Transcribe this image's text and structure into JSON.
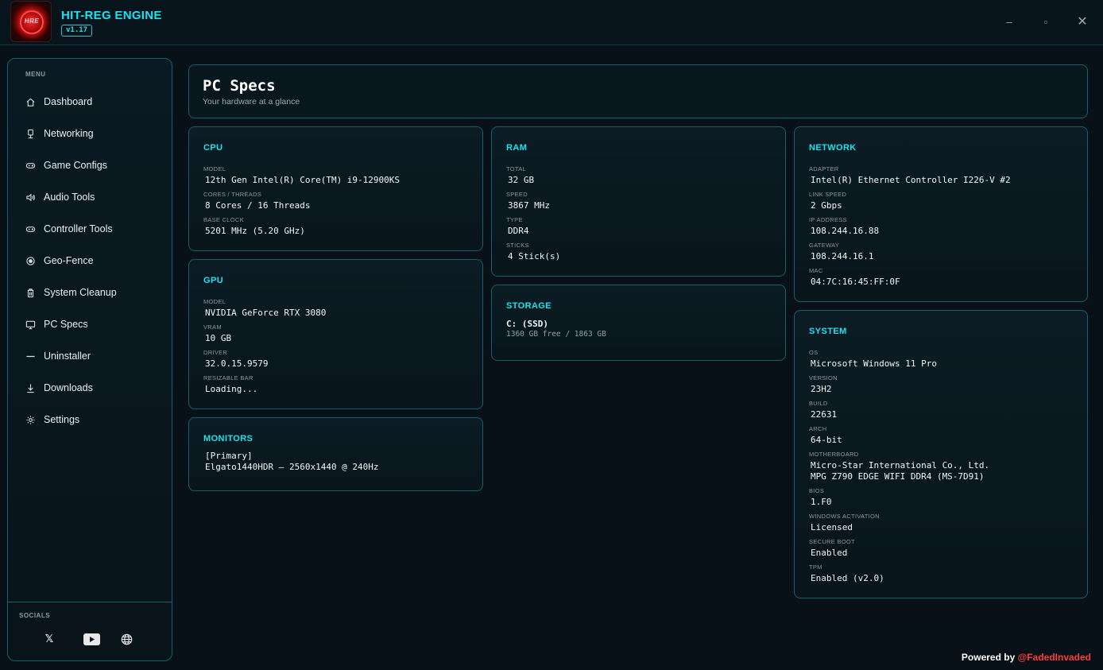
{
  "app": {
    "title": "HIT-REG ENGINE",
    "version": "v1.17",
    "logo_text": "HRE"
  },
  "window_controls": {
    "minimize": "–",
    "maximize": "▫",
    "close": "✕"
  },
  "sidebar": {
    "menu_label": "MENU",
    "items": [
      {
        "label": "Dashboard",
        "icon": "home-icon"
      },
      {
        "label": "Networking",
        "icon": "network-icon"
      },
      {
        "label": "Game Configs",
        "icon": "gamepad-icon"
      },
      {
        "label": "Audio Tools",
        "icon": "speaker-icon"
      },
      {
        "label": "Controller Tools",
        "icon": "controller-icon"
      },
      {
        "label": "Geo-Fence",
        "icon": "target-icon"
      },
      {
        "label": "System Cleanup",
        "icon": "trash-icon"
      },
      {
        "label": "PC Specs",
        "icon": "monitor-icon"
      },
      {
        "label": "Uninstaller",
        "icon": "minus-icon"
      },
      {
        "label": "Downloads",
        "icon": "download-icon"
      },
      {
        "label": "Settings",
        "icon": "gear-icon"
      }
    ],
    "socials_label": "SOCIALS",
    "socials": {
      "x": "𝕏",
      "youtube": "youtube-icon",
      "website": "globe-icon"
    }
  },
  "header": {
    "title": "PC Specs",
    "subtitle": "Your hardware at a glance"
  },
  "cpu": {
    "title": "CPU",
    "fields": [
      {
        "label": "MODEL",
        "value": "12th Gen Intel(R) Core(TM) i9-12900KS"
      },
      {
        "label": "CORES / THREADS",
        "value": "8 Cores / 16 Threads"
      },
      {
        "label": "BASE CLOCK",
        "value": "5201 MHz (5.20 GHz)"
      }
    ]
  },
  "gpu": {
    "title": "GPU",
    "fields": [
      {
        "label": "MODEL",
        "value": "NVIDIA GeForce RTX 3080"
      },
      {
        "label": "VRAM",
        "value": "10 GB"
      },
      {
        "label": "DRIVER",
        "value": "32.0.15.9579"
      },
      {
        "label": "RESIZABLE BAR",
        "value": "Loading..."
      }
    ]
  },
  "monitors": {
    "title": "MONITORS",
    "lines": [
      "[Primary]",
      "Elgato1440HDR — 2560x1440 @ 240Hz"
    ]
  },
  "ram": {
    "title": "RAM",
    "fields": [
      {
        "label": "TOTAL",
        "value": "32 GB"
      },
      {
        "label": "SPEED",
        "value": "3867 MHz"
      },
      {
        "label": "TYPE",
        "value": "DDR4"
      },
      {
        "label": "STICKS",
        "value": "4 Stick(s)"
      }
    ]
  },
  "storage": {
    "title": "STORAGE",
    "drive": "C: (SSD)",
    "free": "1360 GB free / 1863 GB"
  },
  "network": {
    "title": "NETWORK",
    "fields": [
      {
        "label": "ADAPTER",
        "value": "Intel(R) Ethernet Controller I226-V #2"
      },
      {
        "label": "LINK SPEED",
        "value": "2 Gbps"
      },
      {
        "label": "IP ADDRESS",
        "value": "108.244.16.88"
      },
      {
        "label": "GATEWAY",
        "value": "108.244.16.1"
      },
      {
        "label": "MAC",
        "value": "04:7C:16:45:FF:0F"
      }
    ]
  },
  "system": {
    "title": "SYSTEM",
    "fields": [
      {
        "label": "OS",
        "value": "Microsoft Windows 11 Pro"
      },
      {
        "label": "VERSION",
        "value": "23H2"
      },
      {
        "label": "BUILD",
        "value": "22631"
      },
      {
        "label": "ARCH",
        "value": "64-bit"
      },
      {
        "label": "MOTHERBOARD",
        "value": "Micro-Star International Co., Ltd.\nMPG Z790 EDGE WIFI DDR4 (MS-7D91)"
      },
      {
        "label": "BIOS",
        "value": "1.F0"
      },
      {
        "label": "WINDOWS ACTIVATION",
        "value": "Licensed"
      },
      {
        "label": "SECURE BOOT",
        "value": "Enabled"
      },
      {
        "label": "TPM",
        "value": "Enabled (v2.0)"
      }
    ]
  },
  "footer": {
    "prefix": "Powered by ",
    "handle": "@FadedInvaded"
  },
  "colors": {
    "accent": "#19e3f0",
    "border": "#14606c",
    "background": "#071117",
    "brand_red": "#ff3b3b"
  }
}
